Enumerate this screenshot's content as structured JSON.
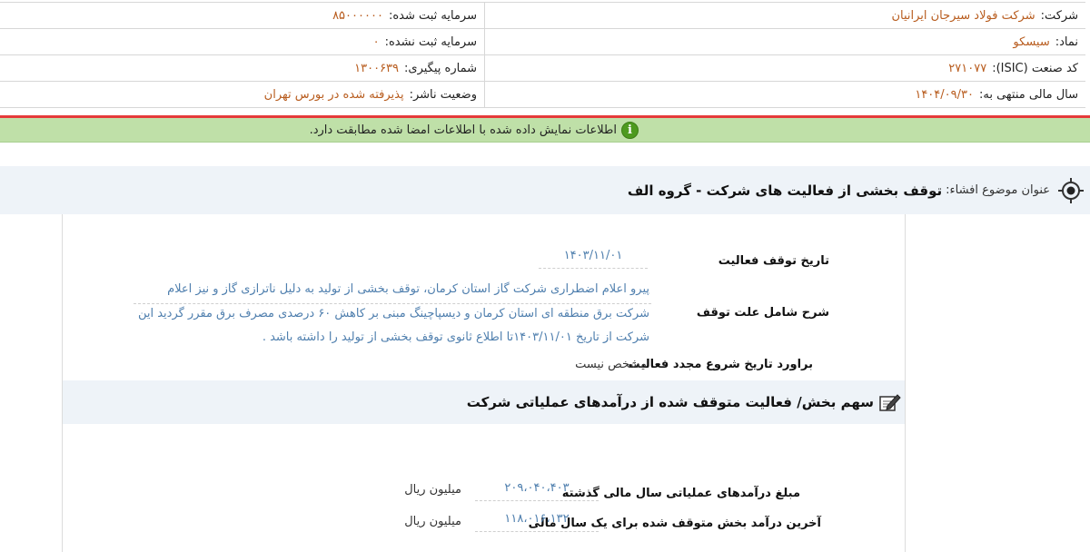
{
  "header": {
    "rows": [
      {
        "right_label": "شرکت:",
        "right_value": "شرکت فولاد سیرجان ایرانیان",
        "left_label": "سرمایه ثبت شده:",
        "left_value": "۸۵۰۰۰۰۰۰"
      },
      {
        "right_label": "نماد:",
        "right_value": "سیسکو",
        "left_label": "سرمایه ثبت نشده:",
        "left_value": "۰"
      },
      {
        "right_label": "کد صنعت (ISIC):",
        "right_value": "۲۷۱۰۷۷",
        "left_label": "شماره پیگیری:",
        "left_value": "۱۳۰۰۶۳۹"
      },
      {
        "right_label": "سال مالی منتهی به:",
        "right_value": "۱۴۰۴/۰۹/۳۰",
        "left_label": "وضعیت ناشر:",
        "left_value": "پذیرفته شده در بورس تهران"
      }
    ]
  },
  "notice": {
    "icon": "info-icon",
    "icon_glyph": "i",
    "message": "اطلاعات نمایش داده شده با اطلاعات امضا شده مطابقت دارد."
  },
  "subject": {
    "icon": "target-icon",
    "label": "عنوان موضوع افشاء:",
    "title": "توقف بخشی از فعالیت های شرکت - گروه الف"
  },
  "details": {
    "stop_date_label": "تاریخ توقف فعالیت",
    "stop_date_value": "۱۴۰۳/۱۱/۰۱",
    "reason_label": "شرح شامل علت توقف",
    "reason_text": "پیرو اعلام اضطراری شرکت گاز استان کرمان، توقف بخشی از تولید به دلیل ناترازی گاز و نیز اعلام شرکت برق منطقه ای استان کرمان و دیسپاچینگ مبنی بر کاهش ۶۰ درصدی مصرف برق مقرر گردید این شرکت از تاریخ ۱۴۰۳/۱۱/۰۱تا اطلاع ثانوی توقف بخشی از تولید را داشته باشد .",
    "restart_label": "براورد تاریخ شروع مجدد فعالیت",
    "restart_value": "مشخص نیست"
  },
  "share_section": {
    "icon": "edit-icon",
    "title": "سهم بخش/ فعالیت متوقف شده از درآمدهای عملیاتی شرکت",
    "rows": [
      {
        "label": "مبلغ درآمدهای عملیاتی سال مالی گذشته",
        "value": "۲۰۹،۰۴۰،۴۰۳",
        "unit": "میلیون ریال"
      },
      {
        "label": "آخرین درآمد بخش متوقف شده برای یک سال مالی",
        "value": "۱۱۸،۰۱۶،۱۳۲",
        "unit": "میلیون ریال"
      }
    ]
  },
  "colors": {
    "value": "#b85c1e",
    "link_value": "#4f7fae",
    "notice_bg": "#bfe0a8",
    "separator": "#e53a3a",
    "section_bg": "#eef3f8"
  }
}
